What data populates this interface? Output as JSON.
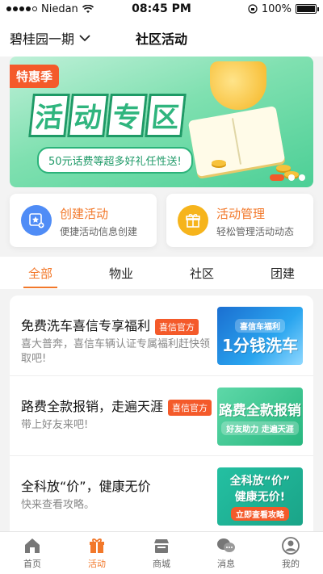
{
  "status_bar": {
    "carrier": "Niedan",
    "time": "08:45 PM",
    "battery": "100%"
  },
  "header": {
    "community": "碧桂园一期",
    "title": "社区活动"
  },
  "banner": {
    "tag": "特惠季",
    "title_chars": [
      "活",
      "动",
      "专",
      "区"
    ],
    "subtitle": "50元话费等超多好礼任性送!",
    "slides_total": 3,
    "active_slide": 1
  },
  "actions": [
    {
      "title": "创建活动",
      "desc": "便捷活动信息创建",
      "icon": "star-add-icon"
    },
    {
      "title": "活动管理",
      "desc": "轻松管理活动动态",
      "icon": "gift-icon"
    }
  ],
  "tabs": [
    {
      "label": "全部",
      "active": true
    },
    {
      "label": "物业",
      "active": false
    },
    {
      "label": "社区",
      "active": false
    },
    {
      "label": "团建",
      "active": false
    }
  ],
  "activities": [
    {
      "title": "免费洗车喜信专享福利",
      "badge": "喜信官方",
      "desc": "喜大普奔，喜信车辆认证专属福利赶快领取吧!",
      "thumb_text": "1分钱洗车",
      "thumb_sub": "喜信车福利"
    },
    {
      "title": "路费全款报销，走遍天涯",
      "badge": "喜信官方",
      "desc": "带上好友来吧!",
      "thumb_text": "路费全款报销",
      "thumb_sub": "好友助力 走遍天涯"
    },
    {
      "title": "全科放“价”，健康无价",
      "badge": "",
      "desc": "快来查看攻略。",
      "thumb_text": "全科放“价” 健康无价!",
      "thumb_sub": "立即查看攻略"
    }
  ],
  "bottom_nav": [
    {
      "label": "首页",
      "icon": "home-icon",
      "active": false
    },
    {
      "label": "活动",
      "icon": "gift-icon",
      "active": true
    },
    {
      "label": "商城",
      "icon": "store-icon",
      "active": false
    },
    {
      "label": "消息",
      "icon": "message-icon",
      "active": false
    },
    {
      "label": "我的",
      "icon": "user-icon",
      "active": false
    }
  ],
  "colors": {
    "accent": "#f2782a",
    "badge": "#f45a2a",
    "blue_icon": "#4f8cf6",
    "yellow_icon": "#f6b41c"
  }
}
